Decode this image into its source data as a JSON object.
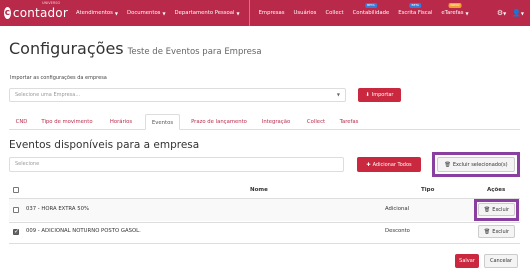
{
  "nav": {
    "logo_text": "contador",
    "logo_sup": "UNIVERSO",
    "items": [
      {
        "label": "Atendimentos",
        "caret": true
      },
      {
        "label": "Documentos",
        "caret": true
      },
      {
        "label": "Departamento Pessoal",
        "caret": true
      },
      {
        "label": "Empresas",
        "caret": false
      },
      {
        "label": "Usuários",
        "caret": false
      },
      {
        "label": "Collect",
        "caret": false
      },
      {
        "label": "Contabilidade",
        "caret": false,
        "badge": "BETA"
      },
      {
        "label": "Escrita Fiscal",
        "caret": false,
        "badge": "BETA"
      },
      {
        "label": "eTarefas",
        "caret": true,
        "badge": "NOVO"
      }
    ],
    "gear_icon": "gear-icon",
    "user_icon": "user-icon",
    "colors": {
      "bar": "#b8294a",
      "badge_blue": "#3a7bd5",
      "badge_orange": "#f0a030"
    }
  },
  "page": {
    "title": "Configurações",
    "subtitle": "Teste de Eventos para Empresa"
  },
  "import": {
    "label": "Importar as configurações da empresa",
    "placeholder": "Selecione uma Empresa...",
    "button": "Importar"
  },
  "tabs": [
    "CND",
    "Tipo de movimento",
    "Horários",
    "Eventos",
    "Prazo de lançamento",
    "Integração",
    "Collect",
    "Tarefas"
  ],
  "active_tab": "Eventos",
  "events": {
    "title": "Eventos disponíveis para a empresa",
    "filter_placeholder": "Selecione",
    "add_all": "Adicionar Todos",
    "delete_selected": "Excluir selecionado(s)",
    "columns": {
      "name": "Nome",
      "type": "Tipo",
      "actions": "Ações"
    },
    "rows": [
      {
        "name": "037 - HORA EXTRA 50%",
        "type": "Adicional",
        "checked": false,
        "action": "Excluir"
      },
      {
        "name": "009 - ADICIONAL NOTURNO POSTO GASOL.",
        "type": "Desconto",
        "checked": true,
        "action": "Excluir"
      }
    ]
  },
  "footer": {
    "save": "Salvar",
    "cancel": "Cancelar"
  },
  "accent": "#c9283e",
  "highlight": "#8a3fa0"
}
